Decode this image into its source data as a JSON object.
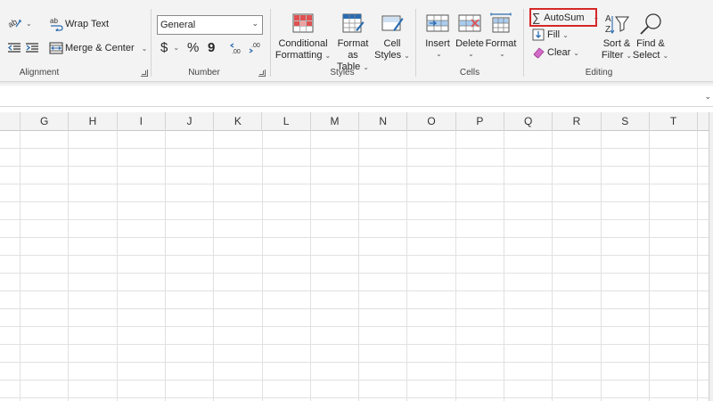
{
  "ribbon": {
    "alignment": {
      "label": "Alignment",
      "wrap_text": "Wrap Text",
      "merge_center": "Merge & Center"
    },
    "number": {
      "label": "Number",
      "format_value": "General",
      "currency_symbol": "$",
      "percent_symbol": "%",
      "comma_symbol": "9",
      "increase_decimal": ".00",
      "decrease_decimal": ".00"
    },
    "styles": {
      "label": "Styles",
      "conditional_formatting": [
        "Conditional",
        "Formatting"
      ],
      "format_as_table": [
        "Format as",
        "Table"
      ],
      "cell_styles": [
        "Cell",
        "Styles"
      ]
    },
    "cells": {
      "label": "Cells",
      "insert": "Insert",
      "delete": "Delete",
      "format": "Format"
    },
    "editing": {
      "label": "Editing",
      "autosum": "AutoSum",
      "fill": "Fill",
      "clear": "Clear",
      "sort_filter": [
        "Sort &",
        "Filter"
      ],
      "find_select": [
        "Find &",
        "Select"
      ]
    }
  },
  "grid": {
    "columns": [
      "G",
      "H",
      "I",
      "J",
      "K",
      "L",
      "M",
      "N",
      "O",
      "P",
      "Q",
      "R",
      "S",
      "T"
    ]
  },
  "colors": {
    "highlight": "#d62728",
    "ribbon_bg": "#f3f3f3",
    "excel_blue": "#2b6cb0",
    "accent_red": "#e05050"
  },
  "icons": {
    "orientation": "orientation-icon",
    "wrap": "wrap-text-icon",
    "merge": "merge-center-icon",
    "indent_decrease": "decrease-indent-icon",
    "indent_increase": "increase-indent-icon",
    "sigma": "sigma-icon",
    "fill": "fill-down-icon",
    "clear": "eraser-icon",
    "sort": "sort-filter-icon",
    "find": "magnifier-icon"
  }
}
